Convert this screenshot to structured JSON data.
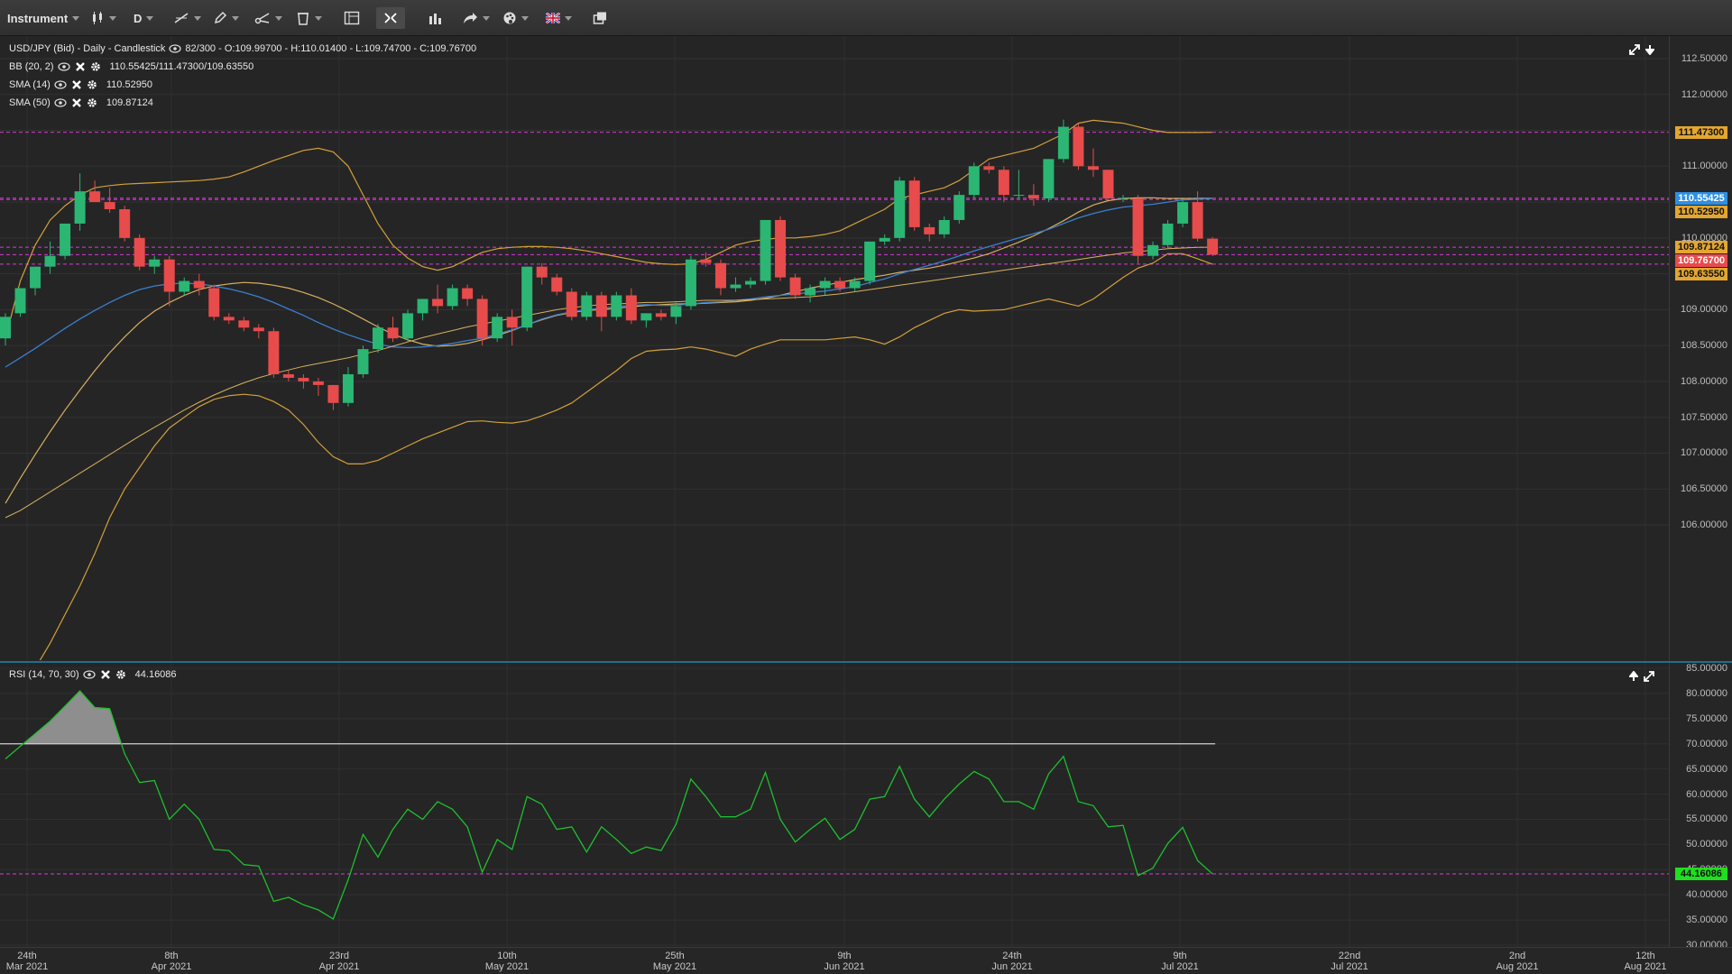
{
  "toolbar": {
    "instrument_label": "Instrument",
    "timeframe_label": "D"
  },
  "main": {
    "title": "USD/JPY (Bid) - Daily - Candlestick",
    "ohlc": "82/300 - O:109.99700 - H:110.01400 - L:109.74700 - C:109.76700",
    "indicators": [
      {
        "name": "BB (20, 2)",
        "value": "110.55425/111.47300/109.63550"
      },
      {
        "name": "SMA (14)",
        "value": "110.52950"
      },
      {
        "name": "SMA (50)",
        "value": "109.87124"
      }
    ]
  },
  "rsi": {
    "name": "RSI (14, 70, 30)",
    "value": "44.16086",
    "values": [
      67,
      69.5,
      72,
      74.5,
      77.5,
      80.5,
      77.2,
      77,
      68,
      62.3,
      62.7,
      55,
      58,
      55,
      49,
      48.8,
      46,
      45.7,
      38.7,
      39.5,
      38,
      37,
      35.2,
      43,
      52,
      47.5,
      53,
      57,
      55,
      58.5,
      57,
      53.5,
      44.5,
      51,
      49,
      59.5,
      58,
      53,
      53.5,
      48.5,
      53.5,
      51,
      48.2,
      49.5,
      48.8,
      54,
      63,
      59.5,
      55.5,
      55.5,
      57,
      64.3,
      55,
      50.5,
      53,
      55.2,
      51,
      53,
      59,
      59.5,
      65.5,
      59,
      55.5,
      59,
      62,
      64.5,
      63,
      58.5,
      58.5,
      57,
      64,
      67.5,
      58.5,
      57.7,
      53.5,
      53.8,
      43.8,
      45.3,
      50.2,
      53.4,
      46.8,
      44.16
    ],
    "overbought": 70,
    "oversold": 30
  },
  "colors": {
    "up": "#2bb673",
    "down": "#e84b4b",
    "bb": "#d3a03a",
    "sma14": "#3a7fd0",
    "sma50": "#d8b060",
    "rsi": "#1ebf2e",
    "marker": "#d63ad6"
  },
  "price_axis": {
    "ticks": [
      "112.50000",
      "112.00000",
      "111.50000",
      "111.00000",
      "110.50000",
      "110.00000",
      "109.50000",
      "109.00000",
      "108.50000",
      "108.00000",
      "107.50000",
      "107.00000",
      "106.50000",
      "106.00000"
    ],
    "tags": [
      {
        "label": "111.47300",
        "price": 111.473,
        "bg": "#e3a630"
      },
      {
        "label": "110.55425",
        "price": 110.554,
        "bg": "#2f8fe0"
      },
      {
        "label": "110.52950",
        "price": 110.38,
        "bg": "#e3a630"
      },
      {
        "label": "109.87124",
        "price": 109.871,
        "bg": "#e3a630"
      },
      {
        "label": "109.76700",
        "price": 109.767,
        "bg": "#e84b4b"
      },
      {
        "label": "109.63550",
        "price": 109.635,
        "bg": "#e3a630"
      }
    ]
  },
  "rsi_axis": {
    "ticks": [
      "85.00000",
      "80.00000",
      "75.00000",
      "70.00000",
      "65.00000",
      "60.00000",
      "55.00000",
      "50.00000",
      "45.00000",
      "40.00000",
      "35.00000",
      "30.00000"
    ],
    "tag": {
      "label": "44.16086",
      "bg": "#1fe01f"
    }
  },
  "time_axis": {
    "labels": [
      {
        "day": "24th",
        "month": "Mar 2021"
      },
      {
        "day": "8th",
        "month": "Apr 2021"
      },
      {
        "day": "23rd",
        "month": "Apr 2021"
      },
      {
        "day": "10th",
        "month": "May 2021"
      },
      {
        "day": "25th",
        "month": "May 2021"
      },
      {
        "day": "9th",
        "month": "Jun 2021"
      },
      {
        "day": "24th",
        "month": "Jun 2021"
      },
      {
        "day": "9th",
        "month": "Jul 2021"
      },
      {
        "day": "22nd",
        "month": "Jul 2021"
      },
      {
        "day": "2nd",
        "month": "Aug 2021"
      },
      {
        "day": "12th",
        "month": "Aug 2021"
      }
    ]
  },
  "chart_data": {
    "type": "candlestick",
    "title": "USD/JPY (Bid) - Daily - Candlestick",
    "ylim": [
      105.9,
      112.62
    ],
    "candles": [
      [
        108.6,
        108.95,
        108.5,
        108.9
      ],
      [
        108.95,
        109.3,
        108.9,
        109.3
      ],
      [
        109.3,
        109.6,
        109.2,
        109.6
      ],
      [
        109.6,
        109.95,
        109.5,
        109.75
      ],
      [
        109.75,
        110.2,
        109.7,
        110.2
      ],
      [
        110.2,
        110.9,
        110.1,
        110.65
      ],
      [
        110.65,
        110.8,
        110.55,
        110.5
      ],
      [
        110.5,
        110.7,
        110.35,
        110.4
      ],
      [
        110.4,
        110.45,
        109.95,
        110.0
      ],
      [
        110.0,
        110.05,
        109.55,
        109.6
      ],
      [
        109.6,
        109.75,
        109.5,
        109.7
      ],
      [
        109.7,
        109.75,
        109.05,
        109.25
      ],
      [
        109.25,
        109.45,
        109.2,
        109.4
      ],
      [
        109.4,
        109.5,
        109.2,
        109.3
      ],
      [
        109.3,
        109.35,
        108.85,
        108.9
      ],
      [
        108.9,
        108.95,
        108.8,
        108.85
      ],
      [
        108.85,
        108.9,
        108.7,
        108.75
      ],
      [
        108.75,
        108.8,
        108.6,
        108.7
      ],
      [
        108.7,
        108.75,
        108.05,
        108.1
      ],
      [
        108.1,
        108.15,
        108.0,
        108.05
      ],
      [
        108.05,
        108.1,
        107.9,
        108.0
      ],
      [
        108.0,
        108.05,
        107.8,
        107.95
      ],
      [
        107.95,
        107.95,
        107.6,
        107.7
      ],
      [
        107.7,
        108.2,
        107.65,
        108.1
      ],
      [
        108.1,
        108.5,
        108.05,
        108.45
      ],
      [
        108.45,
        108.8,
        108.4,
        108.75
      ],
      [
        108.75,
        108.9,
        108.55,
        108.6
      ],
      [
        108.6,
        109.0,
        108.55,
        108.95
      ],
      [
        108.95,
        109.15,
        108.85,
        109.15
      ],
      [
        109.15,
        109.35,
        108.95,
        109.05
      ],
      [
        109.05,
        109.35,
        109.0,
        109.3
      ],
      [
        109.3,
        109.35,
        109.05,
        109.15
      ],
      [
        109.15,
        109.2,
        108.5,
        108.6
      ],
      [
        108.6,
        108.95,
        108.55,
        108.9
      ],
      [
        108.9,
        109.0,
        108.5,
        108.75
      ],
      [
        108.75,
        109.6,
        108.7,
        109.6
      ],
      [
        109.6,
        109.65,
        109.35,
        109.45
      ],
      [
        109.45,
        109.5,
        109.2,
        109.25
      ],
      [
        109.25,
        109.3,
        108.85,
        108.9
      ],
      [
        108.9,
        109.25,
        108.85,
        109.2
      ],
      [
        109.2,
        109.25,
        108.7,
        108.9
      ],
      [
        108.9,
        109.25,
        108.85,
        109.2
      ],
      [
        109.2,
        109.3,
        108.8,
        108.85
      ],
      [
        108.85,
        108.95,
        108.75,
        108.95
      ],
      [
        108.95,
        109.0,
        108.85,
        108.9
      ],
      [
        108.9,
        109.1,
        108.8,
        109.05
      ],
      [
        109.05,
        109.75,
        109.0,
        109.7
      ],
      [
        109.7,
        109.8,
        109.6,
        109.65
      ],
      [
        109.65,
        109.7,
        109.2,
        109.3
      ],
      [
        109.3,
        109.45,
        109.25,
        109.35
      ],
      [
        109.35,
        109.45,
        109.3,
        109.4
      ],
      [
        109.4,
        110.25,
        109.35,
        110.25
      ],
      [
        110.25,
        110.3,
        109.4,
        109.45
      ],
      [
        109.45,
        109.5,
        109.15,
        109.2
      ],
      [
        109.2,
        109.35,
        109.1,
        109.3
      ],
      [
        109.3,
        109.45,
        109.2,
        109.4
      ],
      [
        109.4,
        109.45,
        109.25,
        109.3
      ],
      [
        109.3,
        109.45,
        109.25,
        109.4
      ],
      [
        109.4,
        109.95,
        109.35,
        109.95
      ],
      [
        109.95,
        110.05,
        109.9,
        110.0
      ],
      [
        110.0,
        110.85,
        109.95,
        110.8
      ],
      [
        110.8,
        110.85,
        110.1,
        110.15
      ],
      [
        110.15,
        110.2,
        109.95,
        110.05
      ],
      [
        110.05,
        110.3,
        110.0,
        110.25
      ],
      [
        110.25,
        110.65,
        110.2,
        110.6
      ],
      [
        110.6,
        111.05,
        110.55,
        111.0
      ],
      [
        111.0,
        111.05,
        110.9,
        110.95
      ],
      [
        110.95,
        111.0,
        110.5,
        110.6
      ],
      [
        110.6,
        110.95,
        110.55,
        110.6
      ],
      [
        110.6,
        110.75,
        110.45,
        110.55
      ],
      [
        110.55,
        111.1,
        110.5,
        111.1
      ],
      [
        111.1,
        111.65,
        111.05,
        111.55
      ],
      [
        111.55,
        111.6,
        110.95,
        111.0
      ],
      [
        111.0,
        111.25,
        110.85,
        110.95
      ],
      [
        110.95,
        110.95,
        110.55,
        110.55
      ],
      [
        110.55,
        110.6,
        110.5,
        110.55
      ],
      [
        110.55,
        110.6,
        109.65,
        109.75
      ],
      [
        109.75,
        109.95,
        109.7,
        109.9
      ],
      [
        109.9,
        110.25,
        109.85,
        110.2
      ],
      [
        110.2,
        110.55,
        110.15,
        110.5
      ],
      [
        110.5,
        110.65,
        109.95,
        109.99
      ],
      [
        109.99,
        110.014,
        109.747,
        109.767
      ]
    ],
    "sma14": [
      108.2,
      108.33,
      108.46,
      108.6,
      108.74,
      108.87,
      108.99,
      109.1,
      109.2,
      109.28,
      109.33,
      109.36,
      109.37,
      109.36,
      109.33,
      109.29,
      109.24,
      109.18,
      109.1,
      109.01,
      108.92,
      108.82,
      108.73,
      108.65,
      108.58,
      108.52,
      108.48,
      108.47,
      108.48,
      108.5,
      108.53,
      108.57,
      108.6,
      108.66,
      108.72,
      108.79,
      108.87,
      108.93,
      108.97,
      109.0,
      109.02,
      109.04,
      109.06,
      109.07,
      109.06,
      109.06,
      109.08,
      109.1,
      109.11,
      109.13,
      109.15,
      109.18,
      109.2,
      109.22,
      109.24,
      109.26,
      109.29,
      109.32,
      109.38,
      109.43,
      109.5,
      109.56,
      109.62,
      109.68,
      109.75,
      109.82,
      109.88,
      109.94,
      110.0,
      110.06,
      110.12,
      110.2,
      110.28,
      110.34,
      110.39,
      110.43,
      110.45,
      110.47,
      110.5,
      110.53,
      110.54,
      110.55
    ],
    "sma50": [
      106.1,
      106.2,
      106.33,
      106.46,
      106.59,
      106.72,
      106.85,
      106.98,
      107.11,
      107.24,
      107.36,
      107.48,
      107.6,
      107.71,
      107.81,
      107.9,
      107.98,
      108.05,
      108.11,
      108.16,
      108.21,
      108.25,
      108.29,
      108.33,
      108.38,
      108.43,
      108.49,
      108.55,
      108.61,
      108.66,
      108.71,
      108.76,
      108.8,
      108.84,
      108.88,
      108.92,
      108.96,
      109.0,
      109.03,
      109.05,
      109.07,
      109.08,
      109.09,
      109.1,
      109.1,
      109.11,
      109.12,
      109.13,
      109.13,
      109.13,
      109.14,
      109.15,
      109.16,
      109.17,
      109.18,
      109.2,
      109.22,
      109.25,
      109.28,
      109.31,
      109.34,
      109.37,
      109.4,
      109.43,
      109.46,
      109.49,
      109.52,
      109.55,
      109.58,
      109.61,
      109.64,
      109.67,
      109.7,
      109.73,
      109.76,
      109.79,
      109.81,
      109.83,
      109.85,
      109.86,
      109.87,
      109.871
    ],
    "bb_mid": [
      106.3,
      106.65,
      106.98,
      107.3,
      107.6,
      107.88,
      108.15,
      108.4,
      108.62,
      108.82,
      108.98,
      109.1,
      109.2,
      109.28,
      109.33,
      109.36,
      109.38,
      109.37,
      109.34,
      109.3,
      109.24,
      109.17,
      109.08,
      108.98,
      108.87,
      108.76,
      108.66,
      108.58,
      108.52,
      108.49,
      108.5,
      108.53,
      108.58,
      108.64,
      108.71,
      108.79,
      108.86,
      108.92,
      108.96,
      108.99,
      109.0,
      109.02,
      109.04,
      109.06,
      109.07,
      109.08,
      109.08,
      109.09,
      109.1,
      109.11,
      109.13,
      109.16,
      109.2,
      109.25,
      109.3,
      109.34,
      109.38,
      109.42,
      109.45,
      109.48,
      109.52,
      109.55,
      109.58,
      109.62,
      109.67,
      109.72,
      109.78,
      109.86,
      109.94,
      110.03,
      110.13,
      110.24,
      110.36,
      110.46,
      110.52,
      110.55,
      110.56,
      110.56,
      110.55,
      110.55,
      110.55,
      110.554
    ],
    "bb_upper": [
      108.6,
      109.4,
      109.9,
      110.25,
      110.45,
      110.6,
      110.7,
      110.73,
      110.75,
      110.76,
      110.77,
      110.78,
      110.79,
      110.8,
      110.82,
      110.85,
      110.92,
      111.0,
      111.08,
      111.15,
      111.22,
      111.25,
      111.2,
      111.0,
      110.6,
      110.2,
      109.9,
      109.72,
      109.6,
      109.55,
      109.6,
      109.7,
      109.8,
      109.85,
      109.87,
      109.88,
      109.88,
      109.87,
      109.85,
      109.82,
      109.78,
      109.74,
      109.7,
      109.66,
      109.64,
      109.63,
      109.64,
      109.7,
      109.8,
      109.9,
      109.95,
      109.98,
      110.0,
      110.0,
      110.02,
      110.05,
      110.1,
      110.2,
      110.3,
      110.4,
      110.55,
      110.6,
      110.65,
      110.7,
      110.8,
      110.95,
      111.1,
      111.15,
      111.2,
      111.25,
      111.35,
      111.45,
      111.6,
      111.64,
      111.62,
      111.6,
      111.55,
      111.5,
      111.47,
      111.47,
      111.47,
      111.473
    ],
    "bb_lower": [
      104.0,
      104.0,
      104.0,
      104.35,
      104.75,
      105.15,
      105.6,
      106.1,
      106.5,
      106.8,
      107.1,
      107.35,
      107.5,
      107.65,
      107.75,
      107.8,
      107.82,
      107.8,
      107.72,
      107.6,
      107.4,
      107.15,
      106.95,
      106.85,
      106.85,
      106.9,
      107.0,
      107.1,
      107.2,
      107.28,
      107.36,
      107.44,
      107.45,
      107.43,
      107.42,
      107.45,
      107.52,
      107.6,
      107.7,
      107.85,
      108.0,
      108.15,
      108.32,
      108.42,
      108.44,
      108.45,
      108.48,
      108.45,
      108.4,
      108.35,
      108.45,
      108.52,
      108.58,
      108.58,
      108.58,
      108.58,
      108.6,
      108.62,
      108.58,
      108.52,
      108.62,
      108.75,
      108.85,
      108.95,
      109.0,
      108.98,
      108.99,
      109.0,
      109.05,
      109.1,
      109.15,
      109.1,
      109.05,
      109.15,
      109.3,
      109.45,
      109.58,
      109.65,
      109.78,
      109.78,
      109.71,
      109.635
    ]
  }
}
